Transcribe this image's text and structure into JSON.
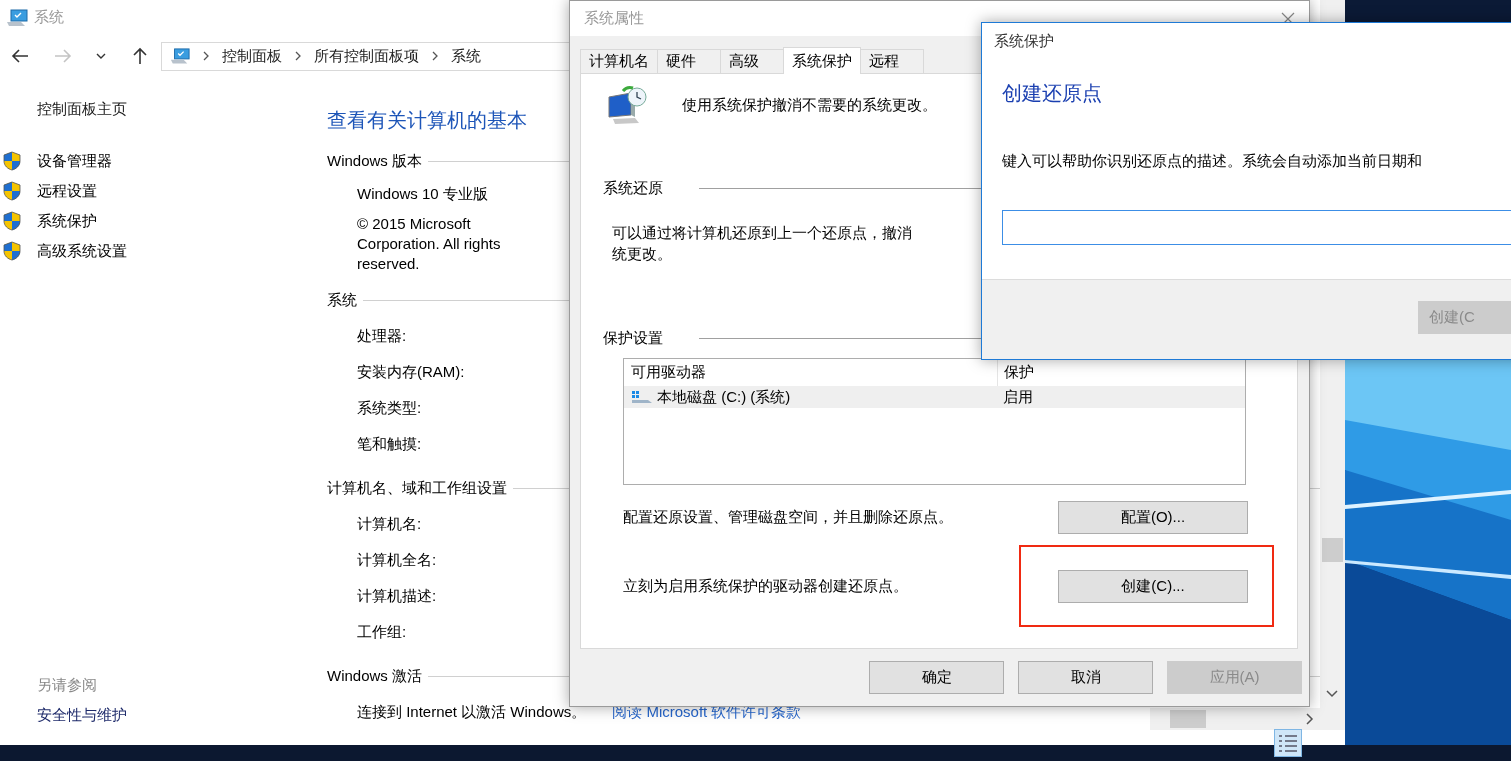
{
  "system_window": {
    "title": "系统",
    "nav_buttons": [
      {
        "kind": "back",
        "disabled": false
      },
      {
        "kind": "forward",
        "disabled": true
      },
      {
        "kind": "recent",
        "disabled": false
      },
      {
        "kind": "up",
        "disabled": false
      }
    ],
    "breadcrumb": [
      "控制面板",
      "所有控制面板项",
      "系统"
    ],
    "sidebar": {
      "home": "控制面板主页",
      "links": [
        "设备管理器",
        "远程设置",
        "系统保护",
        "高级系统设置"
      ],
      "see_also_title": "另请参阅",
      "see_also_links": [
        "安全性与维护"
      ]
    },
    "heading": "查看有关计算机的基本",
    "sections": [
      {
        "title": "Windows 版本",
        "items": [
          {
            "kind": "text",
            "text": "Windows 10 专业版"
          },
          {
            "kind": "text",
            "text": "© 2015 Microsoft Corporation. All rights reserved."
          }
        ]
      },
      {
        "title": "系统",
        "items": [
          {
            "kind": "label",
            "text": "处理器:"
          },
          {
            "kind": "label",
            "text": "安装内存(RAM):"
          },
          {
            "kind": "label",
            "text": "系统类型:"
          },
          {
            "kind": "label",
            "text": "笔和触摸:"
          }
        ]
      },
      {
        "title": "计算机名、域和工作组设置",
        "items": [
          {
            "kind": "label",
            "text": "计算机名:"
          },
          {
            "kind": "label",
            "text": "计算机全名:"
          },
          {
            "kind": "label",
            "text": "计算机描述:"
          },
          {
            "kind": "label",
            "text": "工作组:"
          }
        ]
      },
      {
        "title": "Windows 激活",
        "items": [
          {
            "kind": "activation",
            "text": "连接到 Internet 以激活 Windows。",
            "link": "阅读 Microsoft 软件许可条款"
          }
        ]
      }
    ]
  },
  "properties_dialog": {
    "title": "系统属性",
    "tabs": [
      {
        "label": "计算机名",
        "selected": false
      },
      {
        "label": "硬件",
        "selected": false
      },
      {
        "label": "高级",
        "selected": false
      },
      {
        "label": "系统保护",
        "selected": true
      },
      {
        "label": "远程",
        "selected": false
      }
    ],
    "intro": "使用系统保护撤消不需要的系统更改。",
    "restore_title": "系统还原",
    "restore_text_lines": [
      "可以通过将计算机还原到上一个还原点，撤消",
      "统更改。"
    ],
    "protection_title": "保护设置",
    "columns": [
      "可用驱动器",
      "保护"
    ],
    "rows": [
      {
        "drive": "本地磁盘 (C:) (系统)",
        "protection": "启用",
        "selected": true
      }
    ],
    "configure_text": "配置还原设置、管理磁盘空间，并且删除还原点。",
    "configure_button": "配置(O)...",
    "create_text": "立刻为启用系统保护的驱动器创建还原点。",
    "create_button": "创建(C)...",
    "create_highlighted": true,
    "buttons": [
      {
        "label": "确定",
        "disabled": false
      },
      {
        "label": "取消",
        "disabled": false
      },
      {
        "label": "应用(A)",
        "disabled": true
      }
    ]
  },
  "create_dialog": {
    "title": "系统保护",
    "heading": "创建还原点",
    "description": "键入可以帮助你识别还原点的描述。系统会自动添加当前日期和",
    "input_focused": true,
    "buttons": [
      {
        "label": "创建(C",
        "disabled": true
      }
    ]
  }
}
